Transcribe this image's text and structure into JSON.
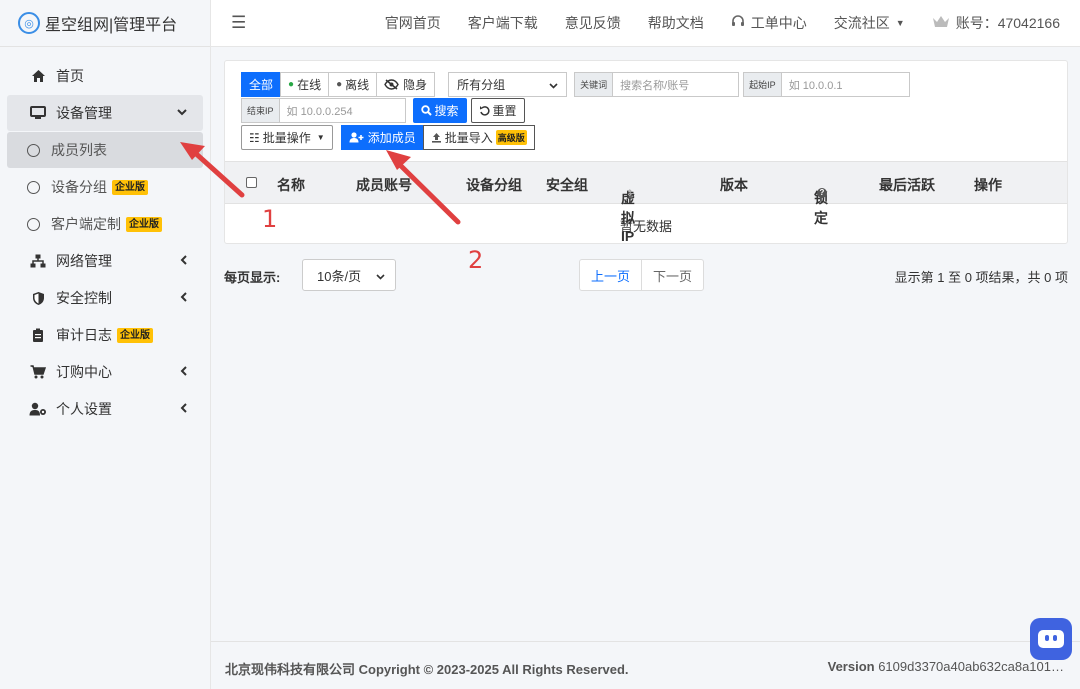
{
  "brand": {
    "title": "星空组网|管理平台"
  },
  "sidebar": {
    "items": [
      {
        "label": "首页",
        "icon": "home-icon"
      },
      {
        "label": "设备管理",
        "icon": "monitor-icon"
      },
      {
        "label": "成员列表"
      },
      {
        "label": "设备分组",
        "badge": "企业版"
      },
      {
        "label": "客户端定制",
        "badge": "企业版"
      },
      {
        "label": "网络管理",
        "icon": "network-icon"
      },
      {
        "label": "安全控制",
        "icon": "shield-icon"
      },
      {
        "label": "审计日志",
        "icon": "clipboard-icon",
        "badge": "企业版"
      },
      {
        "label": "订购中心",
        "icon": "cart-icon"
      },
      {
        "label": "个人设置",
        "icon": "user-cog-icon"
      }
    ]
  },
  "topbar": {
    "links": [
      "官网首页",
      "客户端下载",
      "意见反馈",
      "帮助文档",
      "工单中心",
      "交流社区"
    ],
    "account": "账号：47042166"
  },
  "filters": {
    "status": [
      "全部",
      "在线",
      "离线",
      "隐身"
    ],
    "group_select": "所有分组",
    "keyword_label": "关键词",
    "keyword_placeholder": "搜索名称/账号",
    "start_ip_label": "起始IP",
    "start_ip_placeholder": "如 10.0.0.1",
    "end_ip_label": "结束IP",
    "end_ip_placeholder": "如 10.0.0.254",
    "search_label": "搜索",
    "reset_label": "重置",
    "bulk_label": "批量操作",
    "add_member_label": "添加成员",
    "bulk_import_label": "批量导入",
    "bulk_import_badge": "高级版"
  },
  "table": {
    "columns": [
      "名称",
      "成员账号",
      "设备分组",
      "安全组",
      "虚拟IP",
      "版本",
      "锁定",
      "最后活跃",
      "操作"
    ],
    "empty_text": "暂无数据"
  },
  "pagination": {
    "per_page_label": "每页显示:",
    "per_page_value": "10条/页",
    "prev_label": "上一页",
    "next_label": "下一页",
    "summary": "显示第 1 至 0 项结果，共 0 项"
  },
  "footer": {
    "copyright": "北京现伟科技有限公司 Copyright © 2023-2025 All Rights Reserved.",
    "version_label": "Version",
    "version_value": "6109d3370a40ab632ca8a101…"
  },
  "annotations": {
    "marker1": "1",
    "marker2": "2"
  },
  "colors": {
    "primary": "#0d6efd",
    "badge": "#ffc107",
    "arrow": "#e04040"
  }
}
